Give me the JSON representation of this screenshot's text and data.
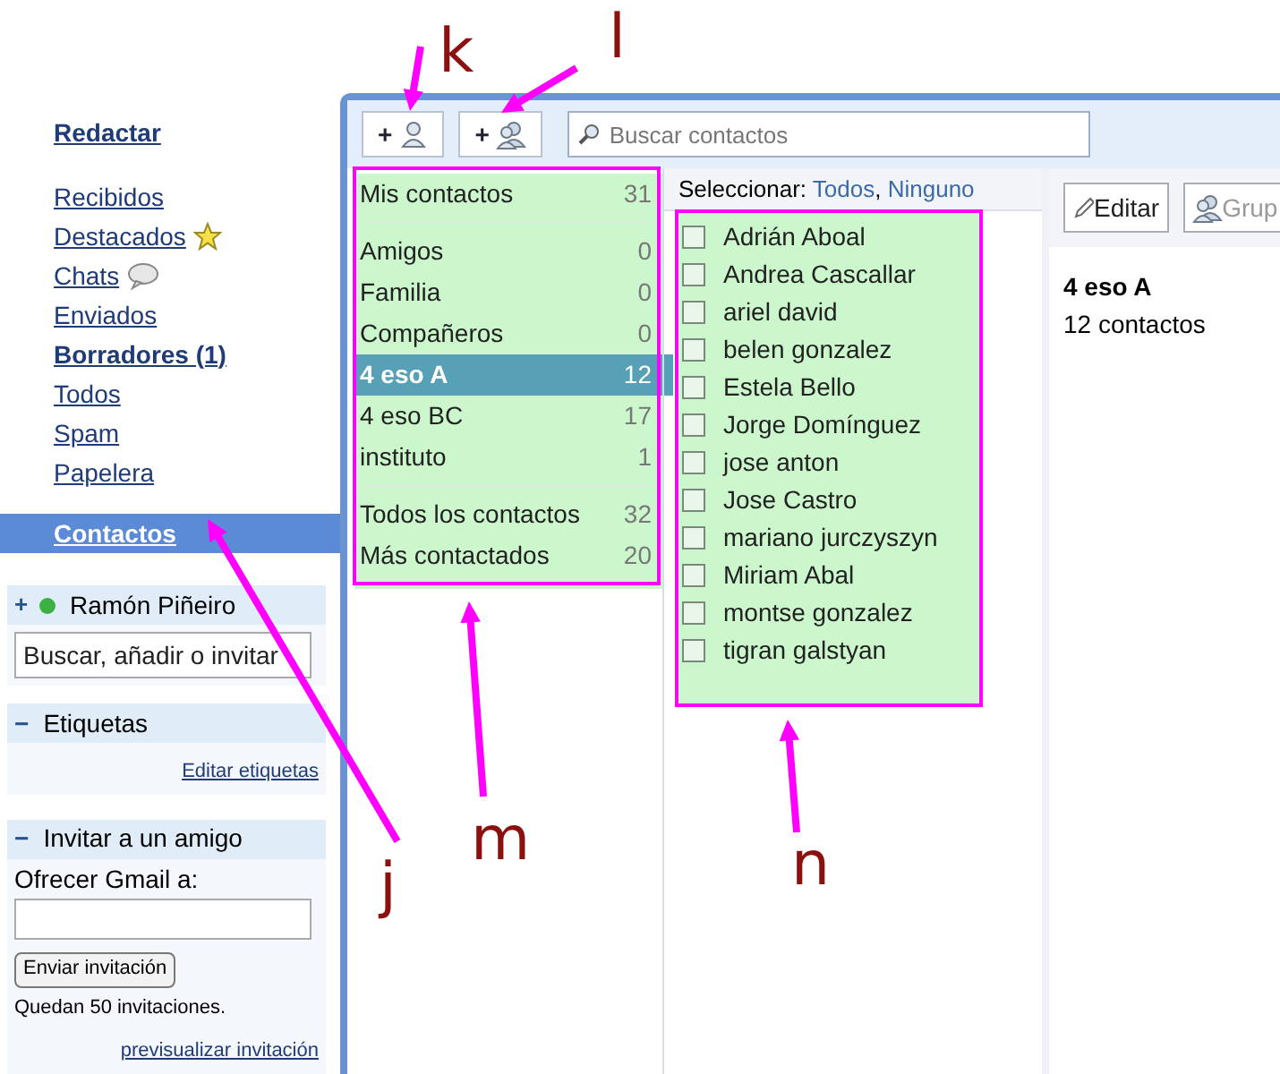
{
  "sidebar": {
    "compose": "Redactar",
    "items": [
      {
        "label": "Recibidos",
        "kind": "plain",
        "bold": false,
        "selected": false
      },
      {
        "label": "Destacados",
        "kind": "star",
        "bold": false,
        "selected": false
      },
      {
        "label": "Chats",
        "kind": "chat",
        "bold": false,
        "selected": false
      },
      {
        "label": "Enviados",
        "kind": "plain",
        "bold": false,
        "selected": false
      },
      {
        "label": "Borradores (1)",
        "kind": "plain",
        "bold": true,
        "selected": false
      },
      {
        "label": "Todos",
        "kind": "plain",
        "bold": false,
        "selected": false
      },
      {
        "label": "Spam",
        "kind": "plain",
        "bold": false,
        "selected": false
      },
      {
        "label": "Papelera",
        "kind": "plain",
        "bold": false,
        "selected": false
      },
      {
        "label": "Contactos",
        "kind": "plain",
        "bold": true,
        "selected": true
      }
    ]
  },
  "chat": {
    "toggle": "+",
    "user": "Ramón Piñeiro",
    "online": true,
    "search": {
      "placeholder": "Buscar, añadir o invitar"
    }
  },
  "labels_box": {
    "toggle": "−",
    "title": "Etiquetas",
    "link": "Editar etiquetas"
  },
  "invite_box": {
    "toggle": "−",
    "title": "Invitar a un amigo",
    "field_label": "Ofrecer Gmail a:",
    "button": "Enviar invitación",
    "remaining": "Quedan 50 invitaciones.",
    "link": "previsualizar invitación"
  },
  "toolbar": {
    "buttons": [
      {
        "plus": "+",
        "kind": "person"
      },
      {
        "plus": "+",
        "kind": "people"
      }
    ],
    "search": {
      "placeholder": "Buscar contactos"
    }
  },
  "groups": [
    [
      {
        "name": "Mis contactos",
        "count": "31",
        "selected": false
      }
    ],
    [
      {
        "name": "Amigos",
        "count": "0",
        "selected": false
      },
      {
        "name": "Familia",
        "count": "0",
        "selected": false
      },
      {
        "name": "Compañeros",
        "count": "0",
        "selected": false
      },
      {
        "name": "4 eso A",
        "count": "12",
        "selected": true
      },
      {
        "name": "4 eso BC",
        "count": "17",
        "selected": false
      },
      {
        "name": "instituto",
        "count": "1",
        "selected": false
      }
    ],
    [
      {
        "name": "Todos los contactos",
        "count": "32",
        "selected": false
      },
      {
        "name": "Más contactados",
        "count": "20",
        "selected": false
      }
    ]
  ],
  "select_bar": {
    "label": "Seleccionar:",
    "links": [
      "Todos",
      "Ninguno"
    ],
    "separator": ","
  },
  "contacts": [
    {
      "name": "Adrián Aboal",
      "checked": false
    },
    {
      "name": "Andrea Cascallar",
      "checked": false
    },
    {
      "name": "ariel david",
      "checked": false
    },
    {
      "name": "belen gonzalez",
      "checked": false
    },
    {
      "name": "Estela Bello",
      "checked": false
    },
    {
      "name": "Jorge Domínguez",
      "checked": false
    },
    {
      "name": "jose anton",
      "checked": false
    },
    {
      "name": "Jose Castro",
      "checked": false
    },
    {
      "name": "mariano jurczyszyn",
      "checked": false
    },
    {
      "name": "Miriam Abal",
      "checked": false
    },
    {
      "name": "montse gonzalez",
      "checked": false
    },
    {
      "name": "tigran galstyan",
      "checked": false
    }
  ],
  "detail": {
    "buttons": [
      {
        "label": "Editar",
        "kind": "pencil"
      },
      {
        "label": "Grup",
        "kind": "people"
      }
    ],
    "title": "4 eso A",
    "subtitle": "12 contactos"
  },
  "annotations": [
    {
      "label": "k"
    },
    {
      "label": "l"
    },
    {
      "label": "j"
    },
    {
      "label": "m"
    },
    {
      "label": "n"
    }
  ]
}
